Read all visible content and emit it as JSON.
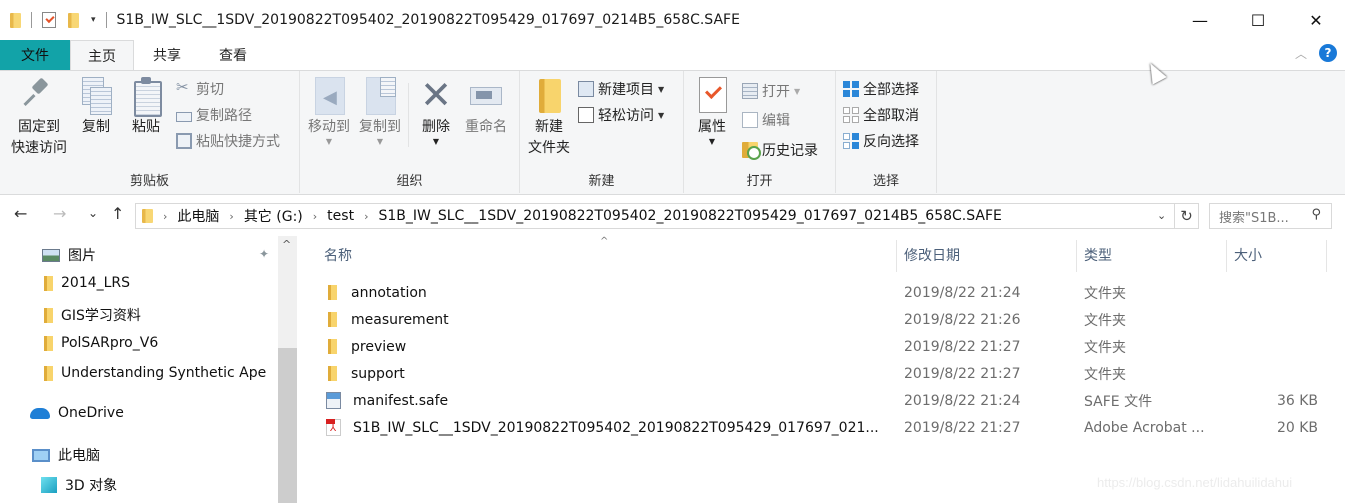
{
  "window": {
    "title": "S1B_IW_SLC__1SDV_20190822T095402_20190822T095429_017697_0214B5_658C.SAFE",
    "controls": {
      "minimize": "—",
      "maximize": "☐",
      "close": "✕"
    },
    "quick_access_dropdown": "▾"
  },
  "tabs": [
    {
      "label": "文件"
    },
    {
      "label": "主页"
    },
    {
      "label": "共享"
    },
    {
      "label": "查看"
    }
  ],
  "ribbon_controls": {
    "collapse": "︿",
    "help": "?"
  },
  "ribbon": {
    "clipboard": {
      "label": "剪贴板",
      "pin": "固定到\n快速访问",
      "pin_line1": "固定到",
      "pin_line2": "快速访问",
      "copy": "复制",
      "paste": "粘贴",
      "cut": "剪切",
      "copy_path": "复制路径",
      "paste_shortcut": "粘贴快捷方式"
    },
    "organize": {
      "label": "组织",
      "move_to": "移动到",
      "copy_to": "复制到",
      "delete": "删除",
      "rename": "重命名"
    },
    "new": {
      "label": "新建",
      "new_folder_line1": "新建",
      "new_folder_line2": "文件夹",
      "new_item": "新建项目",
      "easy_access": "轻松访问"
    },
    "open": {
      "label": "打开",
      "properties": "属性",
      "open": "打开",
      "edit": "编辑",
      "history": "历史记录"
    },
    "select": {
      "label": "选择",
      "select_all": "全部选择",
      "select_none": "全部取消",
      "invert": "反向选择"
    }
  },
  "navigation": {
    "back": "←",
    "forward": "→",
    "recent": "⌄",
    "up": "↑",
    "breadcrumb": [
      "此电脑",
      "其它 (G:)",
      "test",
      "S1B_IW_SLC__1SDV_20190822T095402_20190822T095429_017697_0214B5_658C.SAFE"
    ],
    "crumb_sep": "›",
    "address_dropdown": "⌄",
    "refresh": "↻",
    "search_placeholder": "搜索\"S1B...",
    "search_icon": "⚲"
  },
  "nav_pane": {
    "items": [
      {
        "label": "图片",
        "icon": "pictures-icon",
        "pinned": true
      },
      {
        "label": "2014_LRS",
        "icon": "folder-icon"
      },
      {
        "label": "GIS学习资料",
        "icon": "folder-icon"
      },
      {
        "label": "PolSARpro_V6",
        "icon": "folder-icon"
      },
      {
        "label": "Understanding Synthetic Ape",
        "icon": "folder-icon"
      },
      {
        "label": "OneDrive",
        "icon": "onedrive-icon"
      },
      {
        "label": "此电脑",
        "icon": "this-pc-icon"
      },
      {
        "label": "3D 对象",
        "icon": "3d-objects-icon"
      }
    ],
    "pin_glyph": "📌",
    "scroll_up": "^"
  },
  "file_list": {
    "sort_indicator": "^",
    "columns": [
      "名称",
      "修改日期",
      "类型",
      "大小"
    ],
    "rows": [
      {
        "name": "annotation",
        "date": "2019/8/22 21:24",
        "type": "文件夹",
        "size": "",
        "icon": "folder-icon"
      },
      {
        "name": "measurement",
        "date": "2019/8/22 21:26",
        "type": "文件夹",
        "size": "",
        "icon": "folder-icon"
      },
      {
        "name": "preview",
        "date": "2019/8/22 21:27",
        "type": "文件夹",
        "size": "",
        "icon": "folder-icon"
      },
      {
        "name": "support",
        "date": "2019/8/22 21:27",
        "type": "文件夹",
        "size": "",
        "icon": "folder-icon"
      },
      {
        "name": "manifest.safe",
        "date": "2019/8/22 21:24",
        "type": "SAFE 文件",
        "size": "36 KB",
        "icon": "safe-file-icon"
      },
      {
        "name": "S1B_IW_SLC__1SDV_20190822T095402_20190822T095429_017697_021...",
        "date": "2019/8/22 21:27",
        "type": "Adobe Acrobat ...",
        "size": "20 KB",
        "icon": "pdf-file-icon"
      }
    ]
  },
  "watermark": "https://blog.csdn.net/lidahuilidahui"
}
